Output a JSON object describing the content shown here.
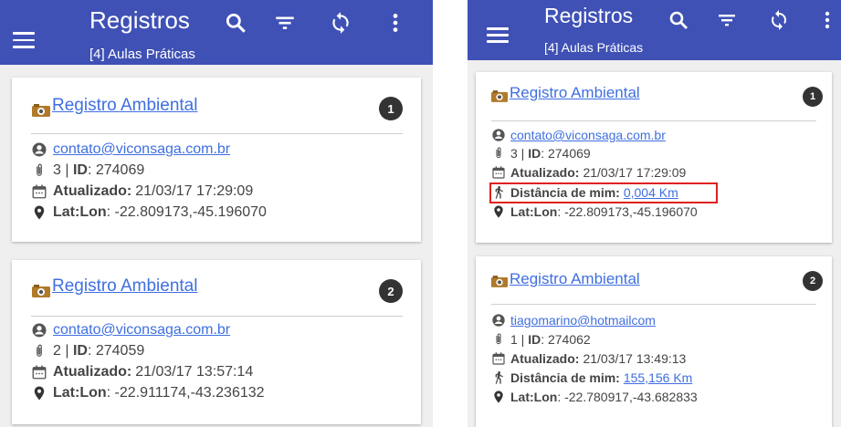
{
  "colors": {
    "appbar": "#3f51b5",
    "link": "#3f6fe0",
    "badge": "#333333",
    "highlight_border": "#e02020"
  },
  "screens": [
    {
      "appbar": {
        "title": "Registros",
        "subtitle": "[4] Aulas Práticas",
        "icons": [
          "menu-icon",
          "search-icon",
          "filter-icon",
          "sync-icon",
          "more-vert-icon"
        ]
      },
      "cards": [
        {
          "icon": "camera-icon",
          "title": "Registro Ambiental",
          "badge": "1",
          "email": "contato@viconsaga.com.br",
          "attachments": "3 |",
          "id_label": "ID",
          "id_value": ": 274069",
          "updated_label": "Atualizado:",
          "updated_value": "21/03/17 17:29:09",
          "latlon_label": "Lat:Lon",
          "latlon_value": ": -22.809173,-45.196070"
        },
        {
          "icon": "camera-icon",
          "title": "Registro Ambiental",
          "badge": "2",
          "email": "contato@viconsaga.com.br",
          "attachments": "2 |",
          "id_label": "ID",
          "id_value": ": 274059",
          "updated_label": "Atualizado:",
          "updated_value": "21/03/17 13:57:14",
          "latlon_label": "Lat:Lon",
          "latlon_value": ": -22.911174,-43.236132"
        }
      ]
    },
    {
      "appbar": {
        "title": "Registros",
        "subtitle": "[4] Aulas Práticas",
        "icons": [
          "menu-icon",
          "search-icon",
          "filter-icon",
          "sync-icon",
          "more-vert-icon"
        ]
      },
      "cards": [
        {
          "icon": "camera-icon",
          "title": "Registro Ambiental",
          "badge": "1",
          "email": "contato@viconsaga.com.br",
          "attachments": "3 |",
          "id_label": "ID",
          "id_value": ": 274069",
          "updated_label": "Atualizado:",
          "updated_value": "21/03/17 17:29:09",
          "distance_label": "Distância de mim:",
          "distance_value": "0,004 Km",
          "distance_highlighted": true,
          "latlon_label": "Lat:Lon",
          "latlon_value": ": -22.809173,-45.196070"
        },
        {
          "icon": "camera-icon",
          "title": "Registro Ambiental",
          "badge": "2",
          "email": "tiagomarino@hotmailcom",
          "attachments": "1 |",
          "id_label": "ID",
          "id_value": ": 274062",
          "updated_label": "Atualizado:",
          "updated_value": "21/03/17 13:49:13",
          "distance_label": "Distância de mim:",
          "distance_value": "155,156 Km",
          "latlon_label": "Lat:Lon",
          "latlon_value": ": -22.780917,-43.682833"
        }
      ]
    }
  ]
}
